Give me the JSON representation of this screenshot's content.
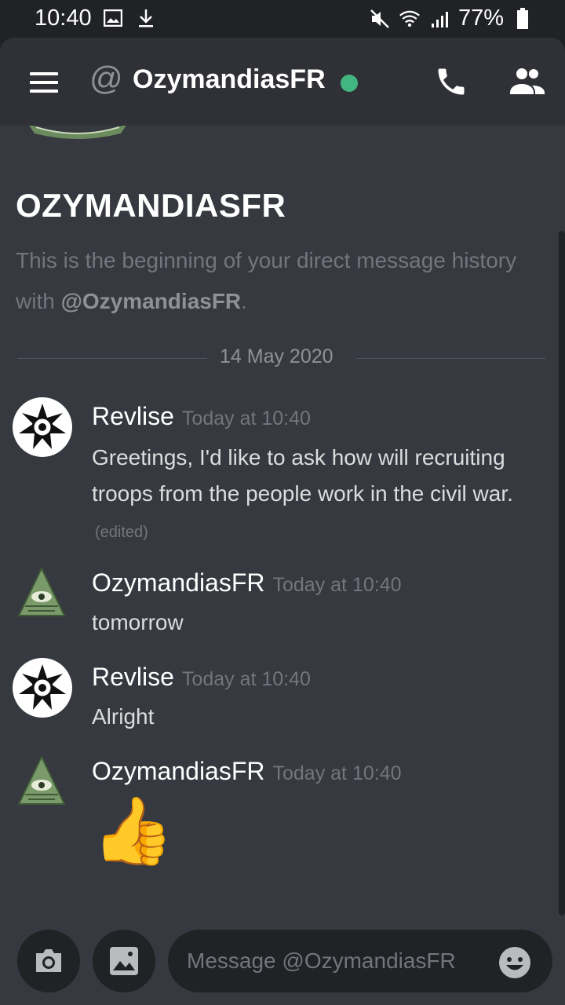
{
  "status_bar": {
    "time": "10:40",
    "battery": "77%",
    "icons": [
      "image-icon",
      "download-icon",
      "mute-icon",
      "wifi-icon",
      "signal-icon",
      "battery-icon"
    ]
  },
  "header": {
    "channel_name": "OzymandiasFR",
    "status": "online",
    "icons": [
      "menu-icon",
      "at-icon",
      "call-icon",
      "members-icon"
    ]
  },
  "welcome": {
    "title": "OZYMANDIASFR",
    "text_prefix": "This is the beginning of your direct message history with ",
    "mention": "@OzymandiasFR",
    "text_suffix": "."
  },
  "divider": {
    "date": "14 May 2020"
  },
  "messages": [
    {
      "author": "Revlise",
      "timestamp": "Today at 10:40",
      "content": "Greetings, I'd like to ask how will recruiting troops from the people work in the civil war.",
      "edited": "(edited)",
      "avatar": "emblem-avatar"
    },
    {
      "author": "OzymandiasFR",
      "timestamp": "Today at 10:40",
      "content": "tomorrow",
      "avatar": "pyramid-eye-avatar"
    },
    {
      "author": "Revlise",
      "timestamp": "Today at 10:40",
      "content": "Alright",
      "avatar": "emblem-avatar"
    },
    {
      "author": "OzymandiasFR",
      "timestamp": "Today at 10:40",
      "content": "👍",
      "avatar": "pyramid-eye-avatar"
    }
  ],
  "composer": {
    "placeholder": "Message @OzymandiasFR",
    "icons": [
      "camera-icon",
      "gallery-icon",
      "emoji-icon"
    ]
  },
  "colors": {
    "background": "#36393f",
    "header": "#2f3136",
    "status_bar": "#202225",
    "online": "#43b581"
  }
}
